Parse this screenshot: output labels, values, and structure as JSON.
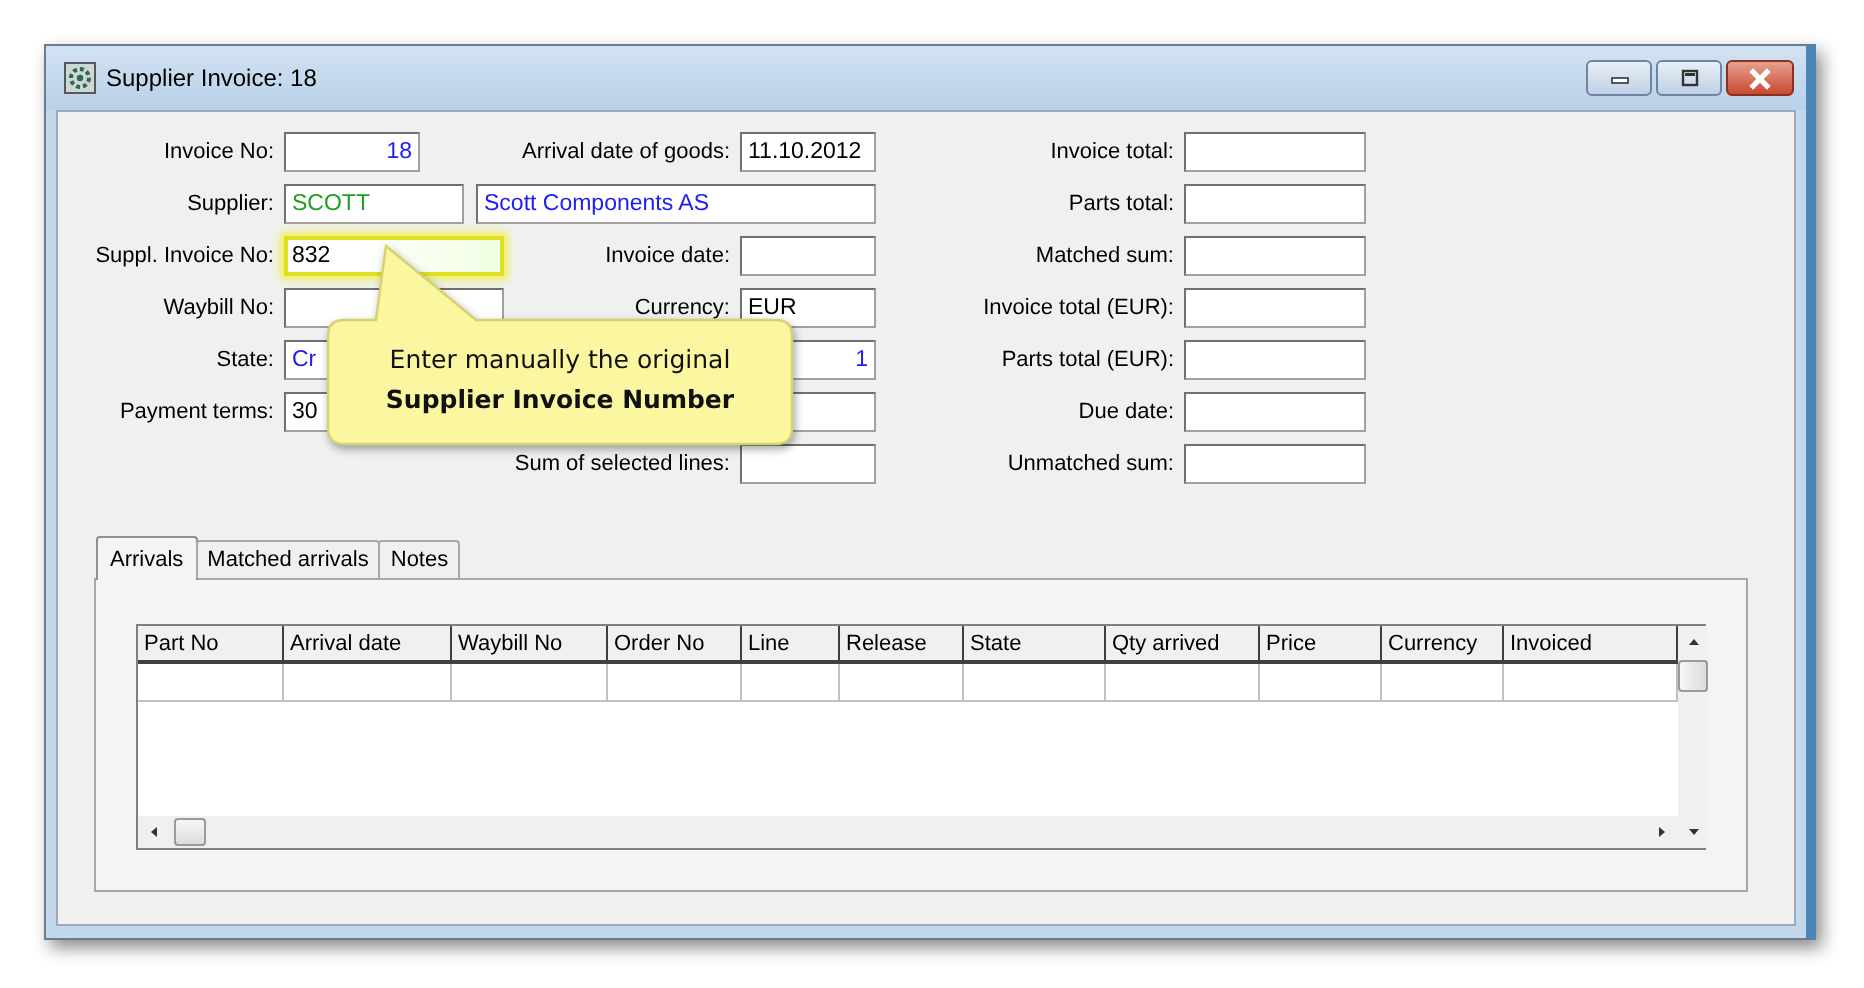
{
  "window": {
    "title": "Supplier Invoice: 18"
  },
  "rows": [
    {
      "left": {
        "label": "Invoice No:",
        "value": "18",
        "color": "#2020f0",
        "kind": "number"
      },
      "middle": {
        "label": "Arrival date of goods:",
        "value": "11.10.2012"
      }
    },
    {
      "left": {
        "label": "Supplier:",
        "value": "SCOTT",
        "color": "#20a020"
      },
      "wide": {
        "value": "Scott Components AS",
        "color": "#2020f0"
      }
    },
    {
      "left": {
        "label": "Suppl. Invoice No:",
        "value": "832",
        "highlighted": true
      },
      "middle": {
        "label": "Invoice date:"
      }
    },
    {
      "left": {
        "label": "Waybill No:"
      },
      "middle": {
        "label": "Currency:",
        "value": "EUR"
      }
    },
    {
      "left": {
        "label": "State:",
        "value": "Cr",
        "color": "#2020f0"
      },
      "middle": {
        "value": "1",
        "color": "#2020f0",
        "kind": "number"
      }
    },
    {
      "left": {
        "label": "Payment terms:",
        "value": "30"
      },
      "middle": {
        "kind": "text"
      }
    },
    {
      "middle": {
        "label": "Sum of selected lines:"
      }
    }
  ],
  "totals": [
    {
      "label": "Invoice total:"
    },
    {
      "label": "Parts total:"
    },
    {
      "label": "Matched sum:"
    },
    {
      "label": "Invoice total (EUR):"
    },
    {
      "label": "Parts total (EUR):"
    },
    {
      "label": "Due date:"
    },
    {
      "label": "Unmatched sum:"
    }
  ],
  "callout": {
    "text": "Enter manually the original **Supplier Invoice Number**"
  },
  "tabs": [
    {
      "label": "Arrivals",
      "selected": true
    },
    {
      "label": "Matched arrivals",
      "selected": false
    },
    {
      "label": "Notes",
      "selected": false
    }
  ],
  "table": {
    "columns": [
      "Part No",
      "Arrival date",
      "Waybill No",
      "Order No",
      "Line",
      "Release",
      "State",
      "Qty arrived",
      "Price",
      "Currency",
      "Invoiced"
    ]
  }
}
